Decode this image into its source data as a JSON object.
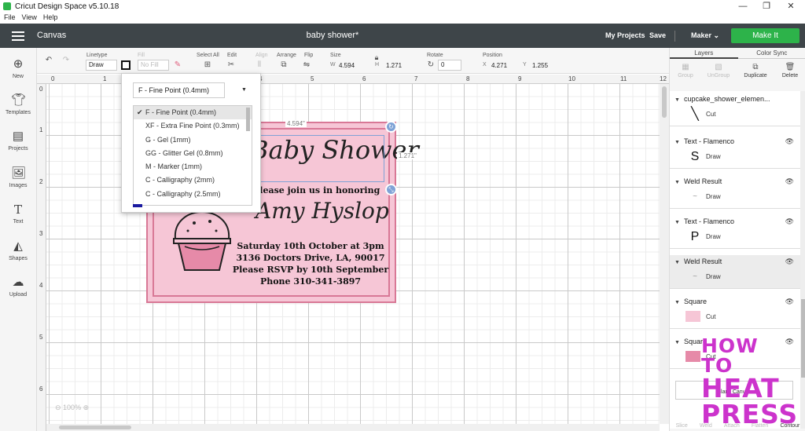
{
  "window": {
    "title": "Cricut Design Space  v5.10.18",
    "minimize": "—",
    "maximize": "❐",
    "close": "✕"
  },
  "menu": [
    "File",
    "View",
    "Help"
  ],
  "header": {
    "canvas_label": "Canvas",
    "doc_title": "baby shower*",
    "my_projects": "My Projects",
    "save": "Save",
    "machine": "Maker",
    "make_it": "Make It",
    "accent": "#2db34a"
  },
  "toolbar": {
    "linetype_label": "Linetype",
    "linetype_value": "Draw",
    "fill_label": "Fill",
    "fill_value": "No Fill",
    "select_all_label": "Select All",
    "edit_label": "Edit",
    "align_label": "Align",
    "arrange_label": "Arrange",
    "flip_label": "Flip",
    "size_label": "Size",
    "size_w_label": "W",
    "size_w": "4.594",
    "size_h_label": "H",
    "size_h": "1.271",
    "rotate_label": "Rotate",
    "rotate_value": "0",
    "position_label": "Position",
    "pos_x_label": "X",
    "pos_x": "4.271",
    "pos_y_label": "Y",
    "pos_y": "1.255"
  },
  "leftbar": [
    {
      "icon": "plus-icon",
      "label": "New"
    },
    {
      "icon": "shirt-icon",
      "label": "Templates"
    },
    {
      "icon": "projects-icon",
      "label": "Projects"
    },
    {
      "icon": "image-icon",
      "label": "Images"
    },
    {
      "icon": "text-icon",
      "label": "Text"
    },
    {
      "icon": "shapes-icon",
      "label": "Shapes"
    },
    {
      "icon": "upload-icon",
      "label": "Upload"
    }
  ],
  "rulers": {
    "top": [
      "0",
      "1",
      "2",
      "3",
      "4",
      "5",
      "6",
      "7",
      "8",
      "9",
      "10",
      "11",
      "12"
    ],
    "left": [
      "0",
      "1",
      "2",
      "3",
      "4",
      "5",
      "6"
    ]
  },
  "canvas": {
    "width_label": "4.594\"",
    "height_label": "1.271\"",
    "zoom": "100%",
    "card": {
      "title": "Baby Shower",
      "line1": "Please join us in honoring",
      "name": "Amy Hyslop",
      "details": [
        "Saturday 10th October at 3pm",
        "3136 Doctors Drive, LA, 90017",
        "Please RSVP by 10th September",
        "Phone 310-341-3897"
      ],
      "pink": "#f6c6d6",
      "border": "#d87896"
    }
  },
  "linetype_dropdown": {
    "selected": "F - Fine Point (0.4mm)",
    "options": [
      "F - Fine Point (0.4mm)",
      "XF - Extra Fine Point (0.3mm)",
      "G - Gel (1mm)",
      "GG - Glitter Gel (0.8mm)",
      "M - Marker (1mm)",
      "C - Calligraphy (2mm)",
      "C - Calligraphy (2.5mm)"
    ],
    "checkmark": "✔"
  },
  "right_panel": {
    "tabs": [
      "Layers",
      "Color Sync"
    ],
    "actions": [
      {
        "label": "Group",
        "icon": "group-icon"
      },
      {
        "label": "UnGroup",
        "icon": "ungroup-icon"
      },
      {
        "label": "Duplicate",
        "icon": "duplicate-icon"
      },
      {
        "label": "Delete",
        "icon": "trash-icon"
      }
    ],
    "layers": [
      {
        "name": "cupcake_shower_elemen...",
        "op": "Cut",
        "thumb": "╲"
      },
      {
        "name": "Text - Flamenco",
        "op": "Draw",
        "thumb": "S"
      },
      {
        "name": "Weld Result",
        "op": "Draw",
        "thumb": "~"
      },
      {
        "name": "Text - Flamenco",
        "op": "Draw",
        "thumb": "P"
      },
      {
        "name": "Weld Result",
        "op": "Draw",
        "thumb": "~"
      },
      {
        "name": "Square",
        "op": "Cut",
        "thumb": ""
      },
      {
        "name": "Square",
        "op": "Cut",
        "thumb": ""
      }
    ],
    "blank_canvas": "Blank Canvas",
    "bottom": [
      "Slice",
      "Weld",
      "Attach",
      "Flatten",
      "Contour"
    ]
  },
  "watermark": {
    "line1": "HOW TO",
    "line2": "HEAT",
    "line3": "PRESS"
  }
}
